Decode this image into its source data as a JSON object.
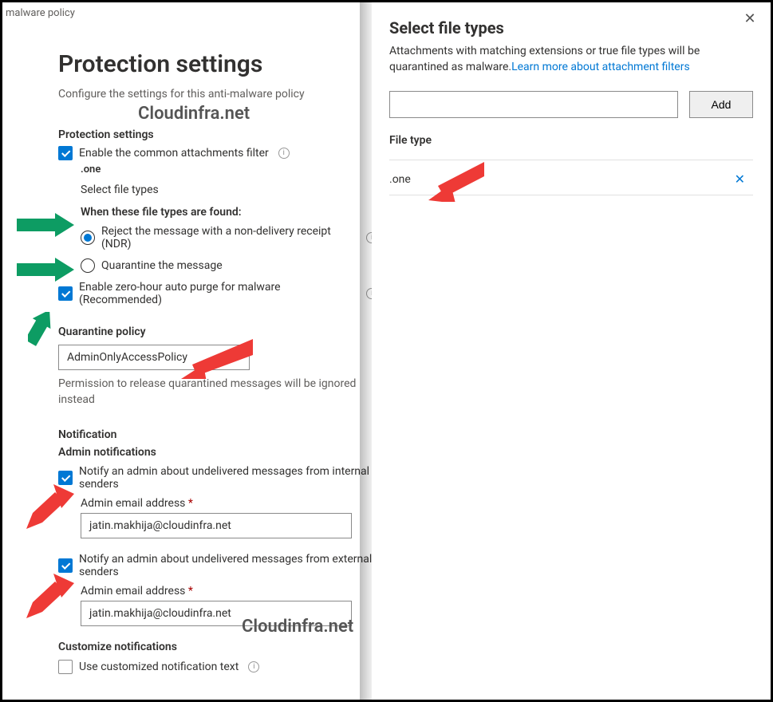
{
  "breadcrumb": "malware policy",
  "watermark": "Cloudinfra.net",
  "left": {
    "title": "Protection settings",
    "subtitle": "Configure the settings for this anti-malware policy",
    "section_protection": "Protection settings",
    "chk_common_filter": "Enable the common attachments filter",
    "ext_one": ".one",
    "select_file_types": "Select file types",
    "when_found": "When these file types are found:",
    "radio_ndr": "Reject the message with a non-delivery receipt (NDR)",
    "radio_quarantine": "Quarantine the message",
    "chk_zap": "Enable zero-hour auto purge for malware (Recommended)",
    "qp_label": "Quarantine policy",
    "qp_value": "AdminOnlyAccessPolicy",
    "qp_note": "Permission to release quarantined messages will be ignored instead",
    "notif_head": "Notification",
    "admin_notif_head": "Admin notifications",
    "chk_notify_internal": "Notify an admin about undelivered messages from internal senders",
    "chk_notify_external": "Notify an admin about undelivered messages from external senders",
    "admin_email_label": "Admin email address",
    "admin_email_value": "jatin.makhija@cloudinfra.net",
    "customize_head": "Customize notifications",
    "chk_customize": "Use customized notification text"
  },
  "flyout": {
    "title": "Select file types",
    "desc1": "Attachments with matching extensions or true file types will be quarantined as malware.",
    "learn_link": "Learn more about attachment filters",
    "add_btn": "Add",
    "ft_header": "File type",
    "ft_value": ".one"
  }
}
